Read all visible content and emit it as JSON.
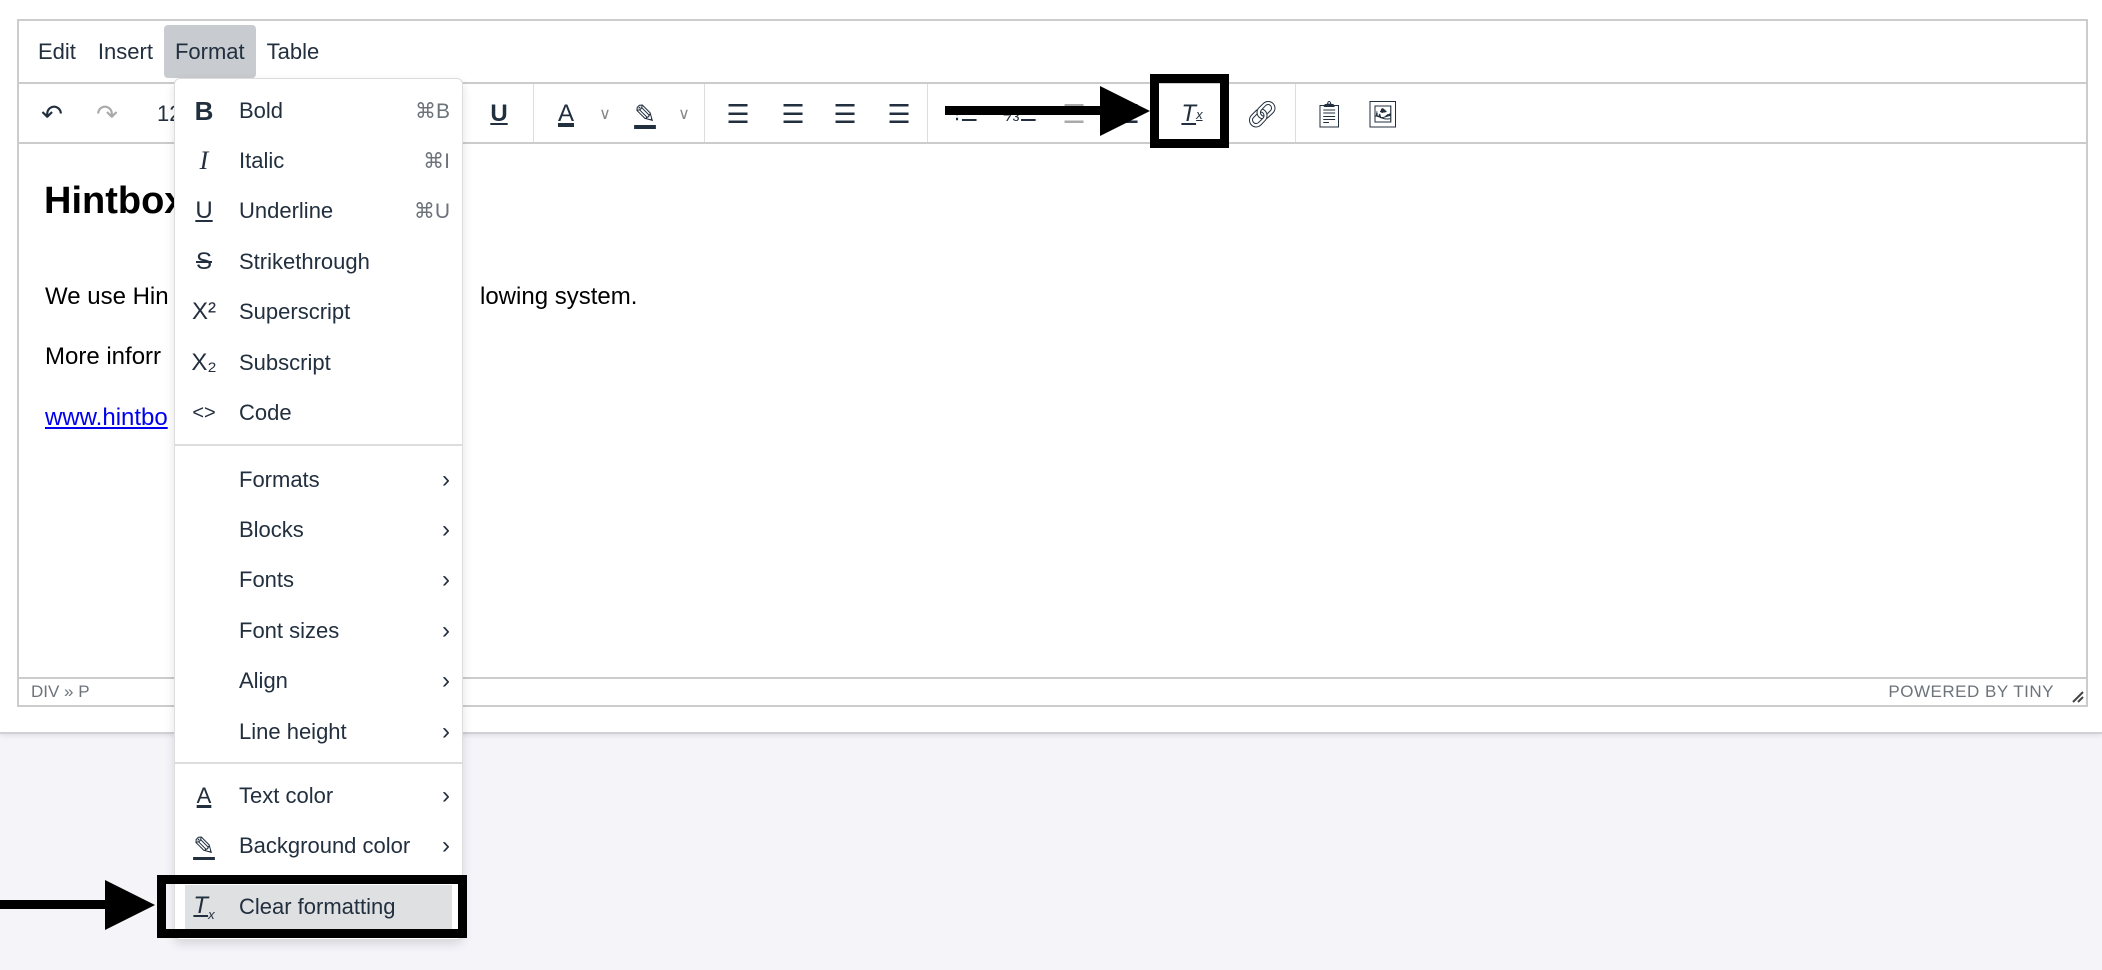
{
  "menubar": {
    "items": [
      "Edit",
      "Insert",
      "Format",
      "Table"
    ],
    "active": "Format"
  },
  "toolbar": {
    "font_size": "12",
    "icons": [
      "undo-icon",
      "redo-icon",
      "underline-icon",
      "text-color-icon",
      "chevron-down-icon",
      "highlight-icon",
      "chevron-down-icon",
      "align-left-icon",
      "align-center-icon",
      "align-right-icon",
      "align-justify-icon",
      "bullet-list-icon",
      "numbered-list-icon",
      "outdent-icon",
      "indent-icon",
      "clear-formatting-icon",
      "link-icon",
      "paste-icon",
      "image-icon"
    ]
  },
  "content": {
    "heading": "Hintbox",
    "para1_left": "We use Hin",
    "para1_right": "lowing system.",
    "para2": "More inforr",
    "link": "www.hintbo"
  },
  "status": {
    "path": "DIV » P",
    "brand": "POWERED BY TINY"
  },
  "format_menu": {
    "items": [
      {
        "label": "Bold",
        "shortcut": "⌘B",
        "icon": "B"
      },
      {
        "label": "Italic",
        "shortcut": "⌘I",
        "icon": "I"
      },
      {
        "label": "Underline",
        "shortcut": "⌘U",
        "icon": "U"
      },
      {
        "label": "Strikethrough",
        "icon": "S"
      },
      {
        "label": "Superscript",
        "icon": "X²"
      },
      {
        "label": "Subscript",
        "icon": "X₂"
      },
      {
        "label": "Code",
        "icon": "<>"
      },
      {
        "label": "Formats"
      },
      {
        "label": "Blocks"
      },
      {
        "label": "Fonts"
      },
      {
        "label": "Font sizes"
      },
      {
        "label": "Align"
      },
      {
        "label": "Line height"
      },
      {
        "label": "Text color",
        "icon": "A"
      },
      {
        "label": "Background color",
        "icon": "✎"
      },
      {
        "label": "Clear formatting",
        "icon": "Tx"
      }
    ],
    "chevron": "›"
  },
  "colors": {
    "accent_highlight": "#dee0e2",
    "menubar_active": "#c8cbcf",
    "link": "#0000ee",
    "annotation": "#000000"
  }
}
